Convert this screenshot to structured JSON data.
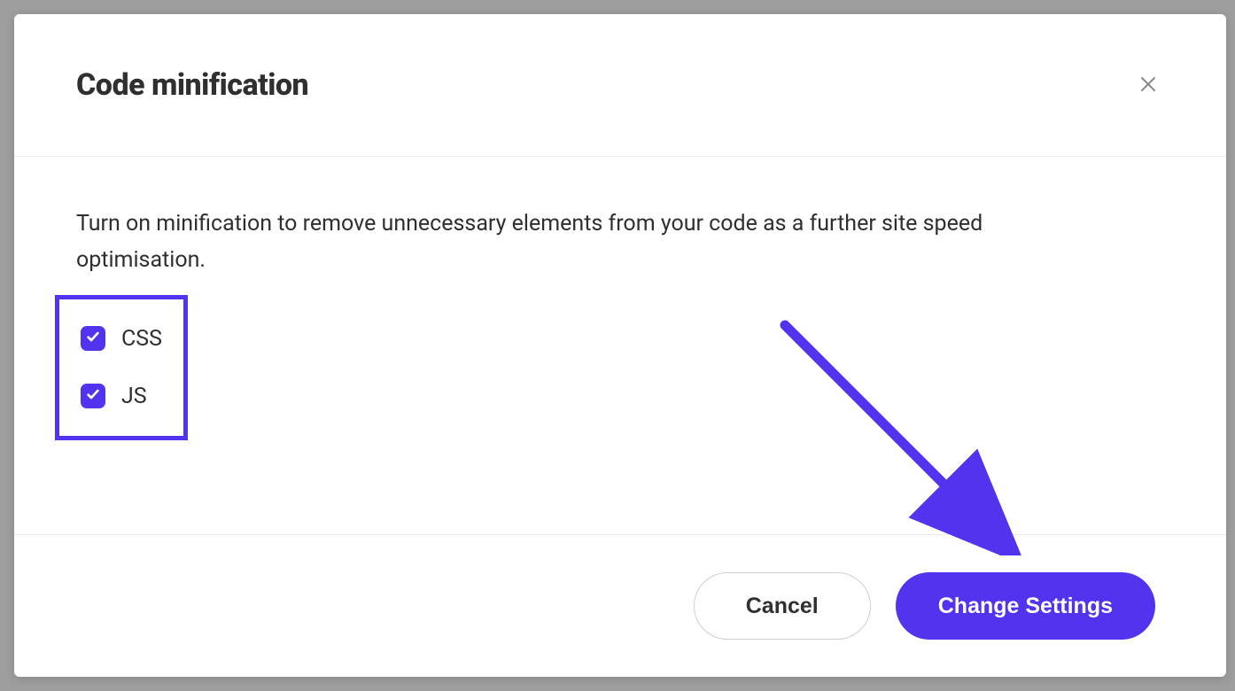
{
  "modal": {
    "title": "Code minification",
    "description": "Turn on minification to remove unnecessary elements from your code as a further site speed optimisation.",
    "options": [
      {
        "label": "CSS",
        "checked": true
      },
      {
        "label": "JS",
        "checked": true
      }
    ],
    "buttons": {
      "cancel": "Cancel",
      "confirm": "Change Settings"
    }
  },
  "colors": {
    "accent": "#5333ed"
  }
}
